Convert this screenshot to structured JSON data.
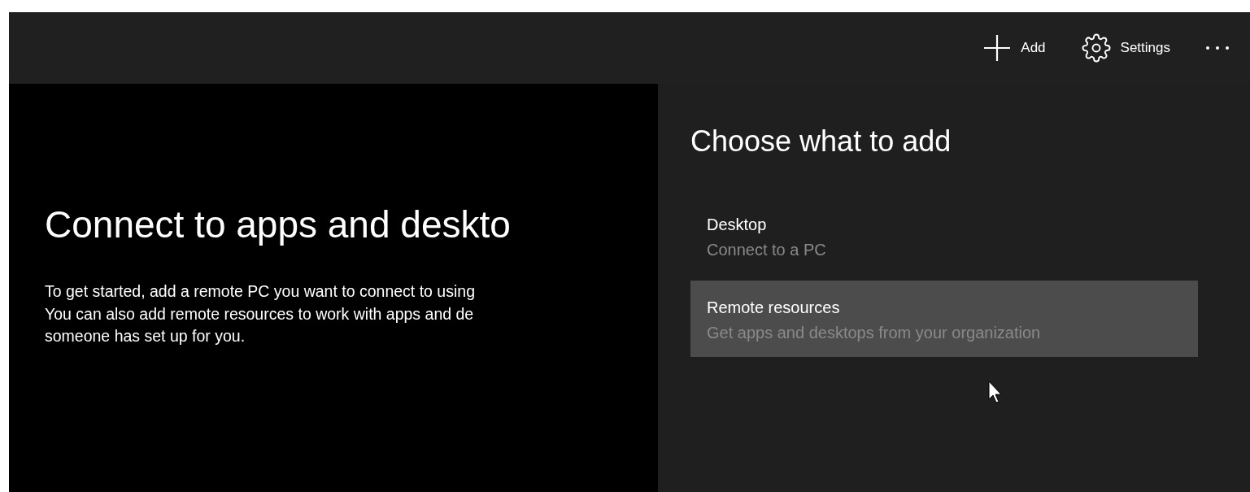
{
  "toolbar": {
    "actions": [
      {
        "kind": "add",
        "label": "Add"
      },
      {
        "kind": "settings",
        "label": "Settings"
      },
      {
        "kind": "more"
      }
    ]
  },
  "main": {
    "title": "Connect to apps and deskto",
    "lines": [
      "To get started, add a remote PC you want to connect to using",
      "You can also add remote resources to work with apps and de",
      "someone has set up for you."
    ]
  },
  "flyout": {
    "title": "Choose what to add",
    "items": [
      {
        "title": "Desktop",
        "subtitle": "Connect to a PC",
        "selected": false
      },
      {
        "title": "Remote resources",
        "subtitle": "Get apps and desktops from your organization",
        "selected": true
      }
    ]
  }
}
